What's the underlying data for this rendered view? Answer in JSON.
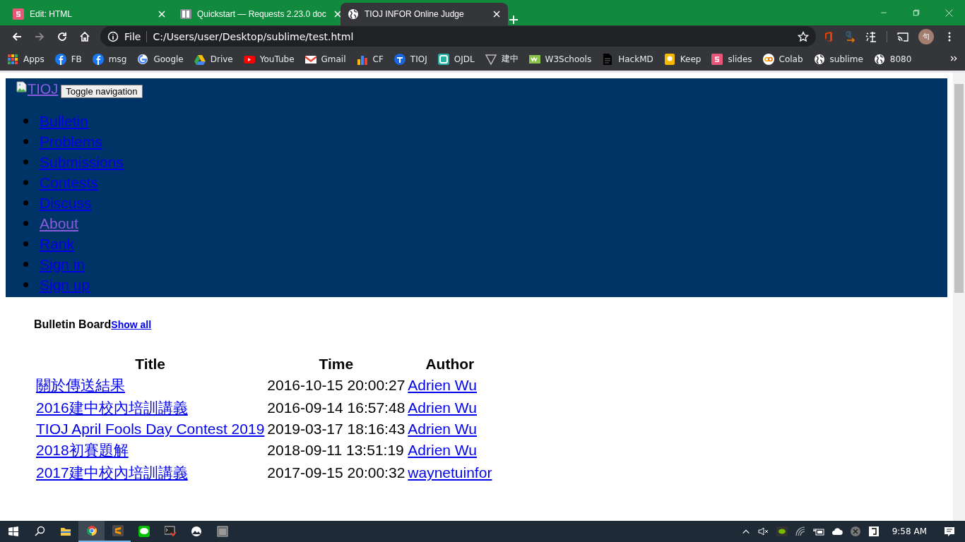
{
  "browser": {
    "tabs": [
      {
        "title": "Edit: HTML",
        "selected": false
      },
      {
        "title": "Quickstart — Requests 2.23.0 doc",
        "selected": false
      },
      {
        "title": "TIOJ INFOR Online Judge",
        "selected": true
      }
    ],
    "address": {
      "scheme": "File",
      "url": "C:/Users/user/Desktop/sublime/test.html"
    },
    "bookmarks": [
      "Apps",
      "FB",
      "msg",
      "Google",
      "Drive",
      "YouTube",
      "Gmail",
      "CF",
      "TIOJ",
      "OJDL",
      "建中",
      "W3Schools",
      "HackMD",
      "Keep",
      "slides",
      "Colab",
      "sublime",
      "8080"
    ],
    "profile_initial": "句"
  },
  "page": {
    "logo_alt": "TIOJ",
    "toggle_button": "Toggle navigation",
    "nav": [
      {
        "label": "Bulletin",
        "visited": false
      },
      {
        "label": "Problems",
        "visited": false
      },
      {
        "label": "Submissions",
        "visited": false
      },
      {
        "label": "Contests",
        "visited": false
      },
      {
        "label": "Discuss",
        "visited": false
      },
      {
        "label": "About",
        "visited": true
      },
      {
        "label": "Rank",
        "visited": false
      },
      {
        "label": "Sign in",
        "visited": false
      },
      {
        "label": "Sign up",
        "visited": false
      }
    ],
    "bulletin": {
      "heading": "Bulletin Board",
      "show_all": "Show all",
      "columns": [
        "Title",
        "Time",
        "Author"
      ],
      "rows": [
        {
          "title": "關於傳送結果",
          "time": "2016-10-15 20:00:27",
          "author": "Adrien Wu"
        },
        {
          "title": "2016建中校內培訓講義",
          "time": "2016-09-14 16:57:48",
          "author": "Adrien Wu"
        },
        {
          "title": "TIOJ April Fools Day Contest 2019",
          "time": "2019-03-17 18:16:43",
          "author": "Adrien Wu"
        },
        {
          "title": "2018初賽題解",
          "time": "2018-09-11 13:51:19",
          "author": "Adrien Wu"
        },
        {
          "title": "2017建中校內培訓講義",
          "time": "2017-09-15 20:00:32",
          "author": "waynetuinfor"
        }
      ]
    }
  },
  "taskbar": {
    "clock": "9:58 AM"
  }
}
